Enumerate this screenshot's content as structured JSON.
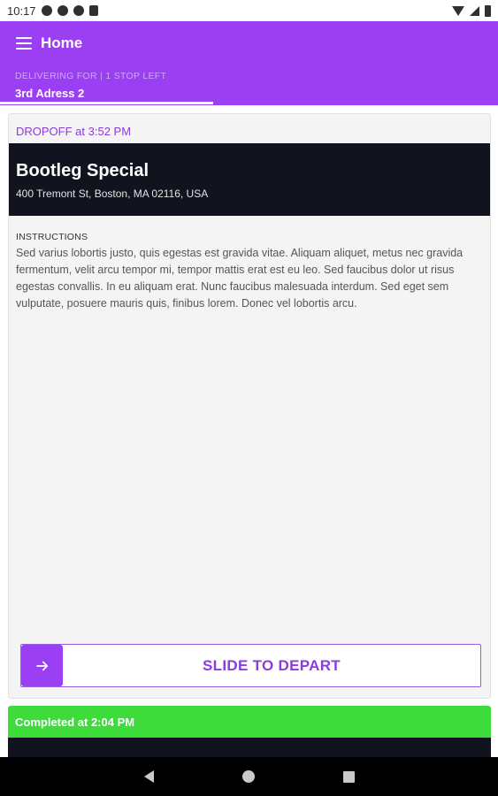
{
  "status_bar": {
    "time": "10:17",
    "icons": [
      "notification-a-icon",
      "notification-p-icon",
      "notification-pin-icon",
      "sd-card-icon"
    ],
    "right_icons": [
      "wifi-icon",
      "signal-icon",
      "battery-icon"
    ]
  },
  "app_bar": {
    "title": "Home",
    "delivering_label": "DELIVERING FOR | 1 STOP LEFT",
    "address_tab": "3rd Adress 2",
    "color": "#9b3ff2"
  },
  "stop_card": {
    "dropoff_label": "DROPOFF at 3:52 PM",
    "venue_name": "Bootleg Special",
    "venue_address": "400 Tremont St, Boston, MA 02116, USA",
    "instructions_title": "INSTRUCTIONS",
    "instructions_text": "Sed varius lobortis justo, quis egestas est gravida vitae. Aliquam aliquet, metus nec gravida fermentum, velit arcu tempor mi, tempor mattis erat est eu leo. Sed faucibus dolor ut risus egestas convallis. In eu aliquam erat. Nunc faucibus malesuada interdum. Sed eget sem vulputate, posuere mauris quis, finibus lorem. Donec vel lobortis arcu.",
    "slide_label": "SLIDE TO DEPART"
  },
  "completed_card": {
    "label": "Completed at 2:04 PM",
    "venue_name_partial": "",
    "color": "#3ddc3a"
  },
  "nav_bar": {
    "buttons": [
      "back-icon",
      "home-icon",
      "recents-icon"
    ]
  }
}
